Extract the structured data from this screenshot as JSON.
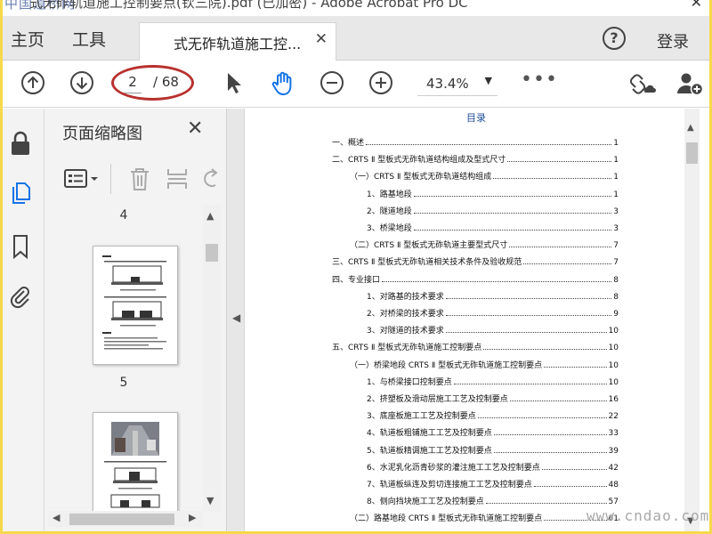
{
  "title_bar": {
    "watermark_logo": "中国道桥网",
    "title": "式无砟轨道施工控制要点(钦三院).pdf (已加密) - Adobe Acrobat Pro DC",
    "close": "✕"
  },
  "tabs": {
    "home": "主页",
    "tools": "工具",
    "document": "式无砟轨道施工控...",
    "document_close": "✕",
    "help": "?",
    "login": "登录"
  },
  "toolbar": {
    "current_page": "2",
    "total_pages": "/ 68",
    "zoom": "43.4%",
    "more": "•••"
  },
  "sidebar_panel": {
    "title": "页面缩略图",
    "close": "✕",
    "thumbnails": [
      {
        "page": "4"
      },
      {
        "page": "5"
      }
    ]
  },
  "document": {
    "toc_title": "目录",
    "toc": [
      {
        "text": "一、概述",
        "page": "1",
        "level": 0
      },
      {
        "text": "二、CRTS Ⅱ 型板式无砟轨道结构组成及型式尺寸",
        "page": "1",
        "level": 0
      },
      {
        "text": "（一）CRTS Ⅱ 型板式无砟轨道结构组成",
        "page": "1",
        "level": 1
      },
      {
        "text": "1、路基地段",
        "page": "1",
        "level": 2
      },
      {
        "text": "2、隧道地段",
        "page": "3",
        "level": 2
      },
      {
        "text": "3、桥梁地段",
        "page": "3",
        "level": 2
      },
      {
        "text": "（二）CRTS Ⅱ 型板式无砟轨道主要型式尺寸",
        "page": "7",
        "level": 1
      },
      {
        "text": "三、CRTS Ⅱ 型板式无砟轨道相关技术条件及验收规范",
        "page": "7",
        "level": 0
      },
      {
        "text": "四、专业接口",
        "page": "8",
        "level": 0
      },
      {
        "text": "1、对路基的技术要求",
        "page": "8",
        "level": 2
      },
      {
        "text": "2、对桥梁的技术要求",
        "page": "9",
        "level": 2
      },
      {
        "text": "3、对隧道的技术要求",
        "page": "10",
        "level": 2
      },
      {
        "text": "五、CRTS Ⅱ 型板式无砟轨道施工控制要点",
        "page": "10",
        "level": 0
      },
      {
        "text": "（一）桥梁地段 CRTS Ⅱ 型板式无砟轨道施工控制要点",
        "page": "10",
        "level": 1
      },
      {
        "text": "1、与桥梁接口控制要点",
        "page": "10",
        "level": 2
      },
      {
        "text": "2、挤塑板及滑动层施工工艺及控制要点",
        "page": "16",
        "level": 2
      },
      {
        "text": "3、底座板施工工艺及控制要点",
        "page": "22",
        "level": 2
      },
      {
        "text": "4、轨道板粗铺施工工艺及控制要点",
        "page": "33",
        "level": 2
      },
      {
        "text": "5、轨道板精调施工工艺及控制要点",
        "page": "39",
        "level": 2
      },
      {
        "text": "6、水泥乳化沥青砂浆的灌注施工工艺及控制要点",
        "page": "42",
        "level": 2
      },
      {
        "text": "7、轨道板纵连及剪切连接施工工艺及控制要点",
        "page": "48",
        "level": 2
      },
      {
        "text": "8、侧向挡块施工工艺及控制要点",
        "page": "57",
        "level": 2
      },
      {
        "text": "（二）路基地段 CRTS Ⅱ 型板式无砟轨道施工控制要点",
        "page": "61",
        "level": 1
      }
    ]
  },
  "watermark": "www.cndao.com",
  "colors": {
    "frame_border": "#f5d94a",
    "accent_blue": "#1473e6",
    "annotation_red": "#b8312f"
  }
}
